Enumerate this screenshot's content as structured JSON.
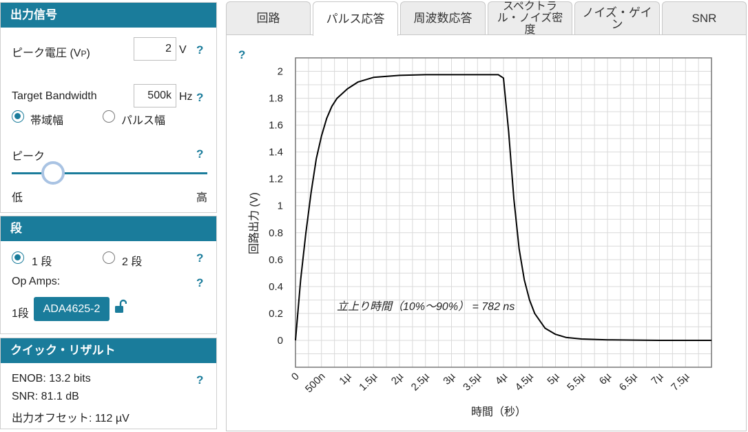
{
  "output_signal": {
    "title": "出力信号",
    "peak_voltage_label": "ピーク電圧 (V",
    "peak_voltage_sub": "P",
    "peak_voltage_close": ")",
    "peak_voltage_value": "2",
    "peak_voltage_unit": "V",
    "bandwidth_label": "Target Bandwidth",
    "bandwidth_value": "500k",
    "bandwidth_unit": "Hz",
    "radio_bandwidth": "帯域幅",
    "radio_pulse": "パルス幅",
    "peak_label": "ピーク",
    "slider_low": "低",
    "slider_high": "高",
    "slider_level": 0.21
  },
  "stages": {
    "title": "段",
    "one_stage": "1 段",
    "two_stage": "2 段",
    "op_amps_label": "Op Amps:",
    "stage1_label": "1段",
    "opamp_button": "ADA4625-2"
  },
  "quick_results": {
    "title": "クイック・リザルト",
    "enob": "ENOB: 13.2 bits",
    "snr": "SNR: 81.1 dB",
    "offset": "出力オフセット: 112 µV"
  },
  "help_mark": "?",
  "tabs": [
    {
      "label": "回路"
    },
    {
      "label": "パルス応答"
    },
    {
      "label": "周波数応答"
    },
    {
      "label": "スペクトラル・ノイズ密度"
    },
    {
      "label": "ノイズ・ゲイン"
    },
    {
      "label": "SNR"
    }
  ],
  "chart_data": {
    "type": "line",
    "xlabel": "時間（秒）",
    "ylabel": "回路出力 (V)",
    "xlim": [
      0,
      8e-06
    ],
    "ylim": [
      -0.2,
      2.1
    ],
    "x_ticks": [
      "0",
      "500n",
      "1µ",
      "1.5µ",
      "2µ",
      "2.5µ",
      "3µ",
      "3.5µ",
      "4µ",
      "4.5µ",
      "5µ",
      "5.5µ",
      "6µ",
      "6.5µ",
      "7µ",
      "7.5µ"
    ],
    "y_ticks": [
      "0",
      "0.2",
      "0.4",
      "0.6",
      "0.8",
      "1",
      "1.2",
      "1.4",
      "1.6",
      "1.8",
      "2"
    ],
    "grid": true,
    "annotation": "立上り時間（10%～90%） = 782 ns",
    "series": [
      {
        "x": [
          0,
          1e-07,
          2e-07,
          3e-07,
          4e-07,
          5e-07,
          6e-07,
          7e-07,
          8e-07,
          1e-06,
          1.2e-06,
          1.5e-06,
          2e-06,
          2.5e-06,
          3e-06,
          3.5e-06,
          3.9e-06,
          4e-06,
          4.1e-06,
          4.2e-06,
          4.3e-06,
          4.4e-06,
          4.5e-06,
          4.6e-06,
          4.8e-06,
          5e-06,
          5.2e-06,
          5.5e-06,
          6e-06,
          6.5e-06,
          7e-06,
          8e-06
        ],
        "y": [
          0,
          0.45,
          0.8,
          1.1,
          1.35,
          1.52,
          1.65,
          1.74,
          1.8,
          1.87,
          1.92,
          1.955,
          1.97,
          1.975,
          1.975,
          1.975,
          1.975,
          1.95,
          1.55,
          1.05,
          0.68,
          0.45,
          0.3,
          0.2,
          0.09,
          0.045,
          0.022,
          0.01,
          0.004,
          0.002,
          0.0,
          0.0
        ]
      }
    ]
  }
}
